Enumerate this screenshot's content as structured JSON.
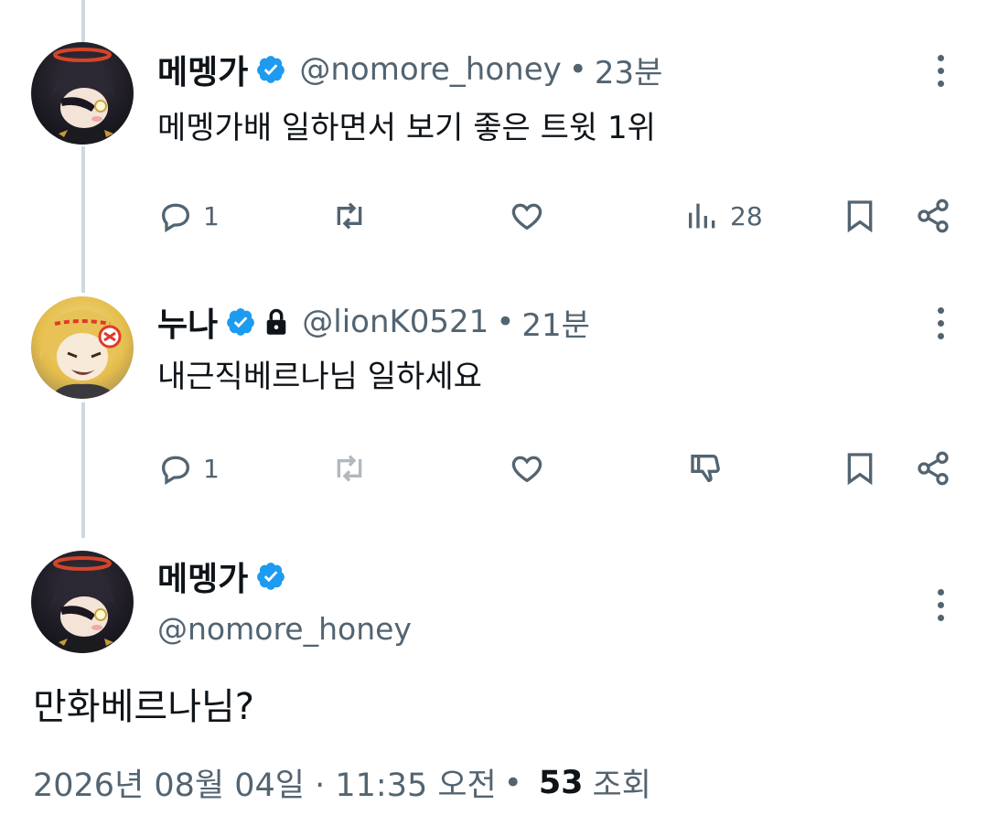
{
  "tweets": [
    {
      "display_name": "메멩가",
      "handle": "@nomore_honey",
      "time": "23분",
      "text": "메멩가배 일하면서 보기 좋은 트윗 1위",
      "reply_count": "1",
      "views": "28"
    },
    {
      "display_name": "누나",
      "handle": "@lionK0521",
      "time": "21분",
      "text": "내근직베르나님 일하세요",
      "reply_count": "1"
    }
  ],
  "main_tweet": {
    "display_name": "메멩가",
    "handle": "@nomore_honey",
    "text": "만화베르나님?",
    "date": "2026년 08월 04일 · 11:35 오전",
    "views_count": "53",
    "views_label": "조회"
  },
  "separator": "•",
  "icons": {
    "verified": "verified-badge-icon",
    "lock": "lock-icon",
    "reply": "reply-icon",
    "retweet": "retweet-icon",
    "like": "heart-icon",
    "views": "views-icon",
    "downvote": "downvote-icon",
    "bookmark": "bookmark-icon",
    "share": "share-icon",
    "more": "more-vertical-icon"
  },
  "colors": {
    "verified_blue": "#1d9bf0",
    "secondary_text": "#536471",
    "thread_line": "#cfd9de"
  }
}
